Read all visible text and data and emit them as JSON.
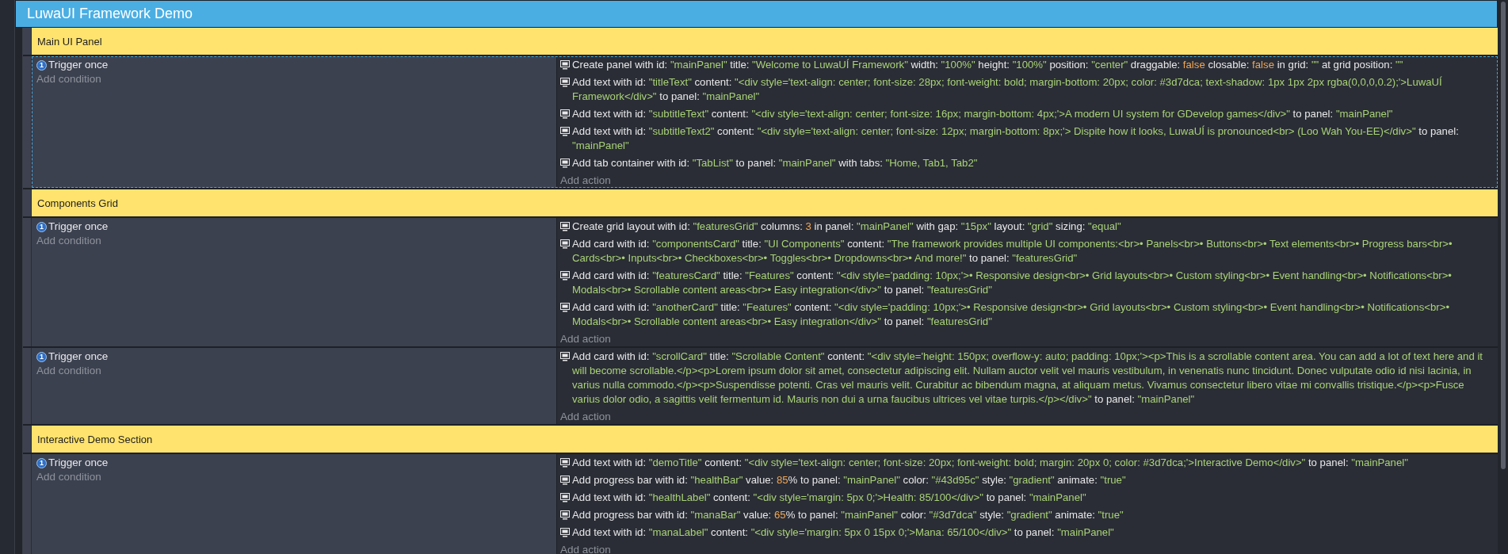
{
  "group": {
    "title": "LuwaUI Framework Demo"
  },
  "sections": [
    {
      "comment": "Main UI Panel",
      "events": [
        {
          "selected": true,
          "conditions": [
            {
              "badge": "1",
              "text": "Trigger once"
            }
          ],
          "add_condition": "Add condition",
          "add_action": "Add action",
          "actions": [
            [
              {
                "kind": "label",
                "text": "Create panel with id: "
              },
              {
                "kind": "string",
                "text": "\"mainPanel\""
              },
              {
                "kind": "label",
                "text": " title: "
              },
              {
                "kind": "string",
                "text": "\"Welcome to LuwaUÍ Framework\""
              },
              {
                "kind": "label",
                "text": " width: "
              },
              {
                "kind": "string",
                "text": "\"100%\""
              },
              {
                "kind": "label",
                "text": " height: "
              },
              {
                "kind": "string",
                "text": "\"100%\""
              },
              {
                "kind": "label",
                "text": " position: "
              },
              {
                "kind": "string",
                "text": "\"center\""
              },
              {
                "kind": "label",
                "text": " draggable: "
              },
              {
                "kind": "literal",
                "text": "false"
              },
              {
                "kind": "label",
                "text": " closable: "
              },
              {
                "kind": "literal",
                "text": "false"
              },
              {
                "kind": "label",
                "text": " in grid: "
              },
              {
                "kind": "string",
                "text": "\"\""
              },
              {
                "kind": "label",
                "text": " at grid position: "
              },
              {
                "kind": "string",
                "text": "\"\""
              }
            ],
            [
              {
                "kind": "label",
                "text": "Add text with id: "
              },
              {
                "kind": "string",
                "text": "\"titleText\""
              },
              {
                "kind": "label",
                "text": " content: "
              },
              {
                "kind": "string",
                "text": "\"<div style='text-align: center; font-size: 28px; font-weight: bold; margin-bottom: 20px; color: #3d7dca; text-shadow: 1px 1px 2px rgba(0,0,0,0.2);'>LuwaUÍ Framework</div>\""
              },
              {
                "kind": "label",
                "text": " to panel: "
              },
              {
                "kind": "string",
                "text": "\"mainPanel\""
              }
            ],
            [
              {
                "kind": "label",
                "text": "Add text with id: "
              },
              {
                "kind": "string",
                "text": "\"subtitleText\""
              },
              {
                "kind": "label",
                "text": " content: "
              },
              {
                "kind": "string",
                "text": "\"<div style='text-align: center; font-size: 16px; margin-bottom: 4px;'>A modern UI system for GDevelop games</div>\""
              },
              {
                "kind": "label",
                "text": " to panel: "
              },
              {
                "kind": "string",
                "text": "\"mainPanel\""
              }
            ],
            [
              {
                "kind": "label",
                "text": "Add text with id: "
              },
              {
                "kind": "string",
                "text": "\"subtitleText2\""
              },
              {
                "kind": "label",
                "text": " content: "
              },
              {
                "kind": "string",
                "text": "\"<div style='text-align: center; font-size: 12px; margin-bottom: 8px;'> Dispite how it looks, LuwaUÍ is pronounced<br> (Loo Wah You-EE)</div>\""
              },
              {
                "kind": "label",
                "text": " to panel: "
              },
              {
                "kind": "string",
                "text": "\"mainPanel\""
              }
            ],
            [
              {
                "kind": "label",
                "text": "Add tab container with id: "
              },
              {
                "kind": "string",
                "text": "\"TabList\""
              },
              {
                "kind": "label",
                "text": " to panel: "
              },
              {
                "kind": "string",
                "text": "\"mainPanel\""
              },
              {
                "kind": "label",
                "text": " with tabs: "
              },
              {
                "kind": "string",
                "text": "\"Home, Tab1, Tab2\""
              }
            ]
          ]
        }
      ]
    },
    {
      "comment": "Components Grid",
      "events": [
        {
          "selected": false,
          "conditions": [
            {
              "badge": "1",
              "text": "Trigger once"
            }
          ],
          "add_condition": "Add condition",
          "add_action": "Add action",
          "actions": [
            [
              {
                "kind": "label",
                "text": "Create grid layout with id: "
              },
              {
                "kind": "string",
                "text": "\"featuresGrid\""
              },
              {
                "kind": "label",
                "text": " columns: "
              },
              {
                "kind": "literal",
                "text": "3"
              },
              {
                "kind": "label",
                "text": " in panel: "
              },
              {
                "kind": "string",
                "text": "\"mainPanel\""
              },
              {
                "kind": "label",
                "text": " with gap: "
              },
              {
                "kind": "string",
                "text": "\"15px\""
              },
              {
                "kind": "label",
                "text": " layout: "
              },
              {
                "kind": "string",
                "text": "\"grid\""
              },
              {
                "kind": "label",
                "text": " sizing: "
              },
              {
                "kind": "string",
                "text": "\"equal\""
              }
            ],
            [
              {
                "kind": "label",
                "text": "Add card with id: "
              },
              {
                "kind": "string",
                "text": "\"componentsCard\""
              },
              {
                "kind": "label",
                "text": " title: "
              },
              {
                "kind": "string",
                "text": "\"UI Components\""
              },
              {
                "kind": "label",
                "text": " content: "
              },
              {
                "kind": "string",
                "text": "\"The framework provides multiple UI components:<br>• Panels<br>• Buttons<br>• Text elements<br>• Progress bars<br>• Cards<br>• Inputs<br>• Checkboxes<br>• Toggles<br>• Dropdowns<br>• And more!\""
              },
              {
                "kind": "label",
                "text": " to panel: "
              },
              {
                "kind": "string",
                "text": "\"featuresGrid\""
              }
            ],
            [
              {
                "kind": "label",
                "text": "Add card with id: "
              },
              {
                "kind": "string",
                "text": "\"featuresCard\""
              },
              {
                "kind": "label",
                "text": " title: "
              },
              {
                "kind": "string",
                "text": "\"Features\""
              },
              {
                "kind": "label",
                "text": " content: "
              },
              {
                "kind": "string",
                "text": "\"<div style='padding: 10px;'>• Responsive design<br>• Grid layouts<br>• Custom styling<br>• Event handling<br>• Notifications<br>• Modals<br>• Scrollable content areas<br>• Easy integration</div>\""
              },
              {
                "kind": "label",
                "text": " to panel: "
              },
              {
                "kind": "string",
                "text": "\"featuresGrid\""
              }
            ],
            [
              {
                "kind": "label",
                "text": "Add card with id: "
              },
              {
                "kind": "string",
                "text": "\"anotherCard\""
              },
              {
                "kind": "label",
                "text": " title: "
              },
              {
                "kind": "string",
                "text": "\"Features\""
              },
              {
                "kind": "label",
                "text": " content: "
              },
              {
                "kind": "string",
                "text": "\"<div style='padding: 10px;'>• Responsive design<br>• Grid layouts<br>• Custom styling<br>• Event handling<br>• Notifications<br>• Modals<br>• Scrollable content areas<br>• Easy integration</div>\""
              },
              {
                "kind": "label",
                "text": " to panel: "
              },
              {
                "kind": "string",
                "text": "\"featuresGrid\""
              }
            ]
          ]
        },
        {
          "selected": false,
          "conditions": [
            {
              "badge": "1",
              "text": "Trigger once"
            }
          ],
          "add_condition": "Add condition",
          "add_action": "Add action",
          "actions": [
            [
              {
                "kind": "label",
                "text": "Add card with id: "
              },
              {
                "kind": "string",
                "text": "\"scrollCard\""
              },
              {
                "kind": "label",
                "text": " title: "
              },
              {
                "kind": "string",
                "text": "\"Scrollable Content\""
              },
              {
                "kind": "label",
                "text": " content: "
              },
              {
                "kind": "string",
                "text": "\"<div style='height: 150px; overflow-y: auto; padding: 10px;'><p>This is a scrollable content area. You can add a lot of text here and it will become scrollable.</p><p>Lorem ipsum dolor sit amet, consectetur adipiscing elit. Nullam auctor velit vel mauris vestibulum, in venenatis nunc tincidunt. Donec vulputate odio id nisi lacinia, in varius nulla commodo.</p><p>Suspendisse potenti. Cras vel mauris velit. Curabitur ac bibendum magna, at aliquam metus. Vivamus consectetur libero vitae mi convallis tristique.</p><p>Fusce varius dolor odio, a sagittis velit fermentum id. Mauris non dui a urna faucibus ultrices vel vitae turpis.</p></div>\""
              },
              {
                "kind": "label",
                "text": " to panel: "
              },
              {
                "kind": "string",
                "text": "\"mainPanel\""
              }
            ]
          ]
        }
      ]
    },
    {
      "comment": "Interactive Demo Section",
      "events": [
        {
          "selected": false,
          "conditions": [
            {
              "badge": "1",
              "text": "Trigger once"
            }
          ],
          "add_condition": "Add condition",
          "add_action": "Add action",
          "actions": [
            [
              {
                "kind": "label",
                "text": "Add text with id: "
              },
              {
                "kind": "string",
                "text": "\"demoTitle\""
              },
              {
                "kind": "label",
                "text": " content: "
              },
              {
                "kind": "string",
                "text": "\"<div style='text-align: center; font-size: 20px; font-weight: bold; margin: 20px 0; color: #3d7dca;'>Interactive Demo</div>\""
              },
              {
                "kind": "label",
                "text": " to panel: "
              },
              {
                "kind": "string",
                "text": "\"mainPanel\""
              }
            ],
            [
              {
                "kind": "label",
                "text": "Add progress bar with id: "
              },
              {
                "kind": "string",
                "text": "\"healthBar\""
              },
              {
                "kind": "label",
                "text": " value: "
              },
              {
                "kind": "literal",
                "text": "85"
              },
              {
                "kind": "label",
                "text": "% to panel: "
              },
              {
                "kind": "string",
                "text": "\"mainPanel\""
              },
              {
                "kind": "label",
                "text": " color: "
              },
              {
                "kind": "string",
                "text": "\"#43d95c\""
              },
              {
                "kind": "label",
                "text": " style: "
              },
              {
                "kind": "string",
                "text": "\"gradient\""
              },
              {
                "kind": "label",
                "text": " animate: "
              },
              {
                "kind": "string",
                "text": "\"true\""
              }
            ],
            [
              {
                "kind": "label",
                "text": "Add text with id: "
              },
              {
                "kind": "string",
                "text": "\"healthLabel\""
              },
              {
                "kind": "label",
                "text": " content: "
              },
              {
                "kind": "string",
                "text": "\"<div style='margin: 5px 0;'>Health: 85/100</div>\""
              },
              {
                "kind": "label",
                "text": " to panel: "
              },
              {
                "kind": "string",
                "text": "\"mainPanel\""
              }
            ],
            [
              {
                "kind": "label",
                "text": "Add progress bar with id: "
              },
              {
                "kind": "string",
                "text": "\"manaBar\""
              },
              {
                "kind": "label",
                "text": " value: "
              },
              {
                "kind": "literal",
                "text": "65"
              },
              {
                "kind": "label",
                "text": "% to panel: "
              },
              {
                "kind": "string",
                "text": "\"mainPanel\""
              },
              {
                "kind": "label",
                "text": " color: "
              },
              {
                "kind": "string",
                "text": "\"#3d7dca\""
              },
              {
                "kind": "label",
                "text": " style: "
              },
              {
                "kind": "string",
                "text": "\"gradient\""
              },
              {
                "kind": "label",
                "text": " animate: "
              },
              {
                "kind": "string",
                "text": "\"true\""
              }
            ],
            [
              {
                "kind": "label",
                "text": "Add text with id: "
              },
              {
                "kind": "string",
                "text": "\"manaLabel\""
              },
              {
                "kind": "label",
                "text": " content: "
              },
              {
                "kind": "string",
                "text": "\"<div style='margin: 5px 0 15px 0;'>Mana: 65/100</div>\""
              },
              {
                "kind": "label",
                "text": " to panel: "
              },
              {
                "kind": "string",
                "text": "\"mainPanel\""
              }
            ]
          ]
        }
      ]
    }
  ]
}
